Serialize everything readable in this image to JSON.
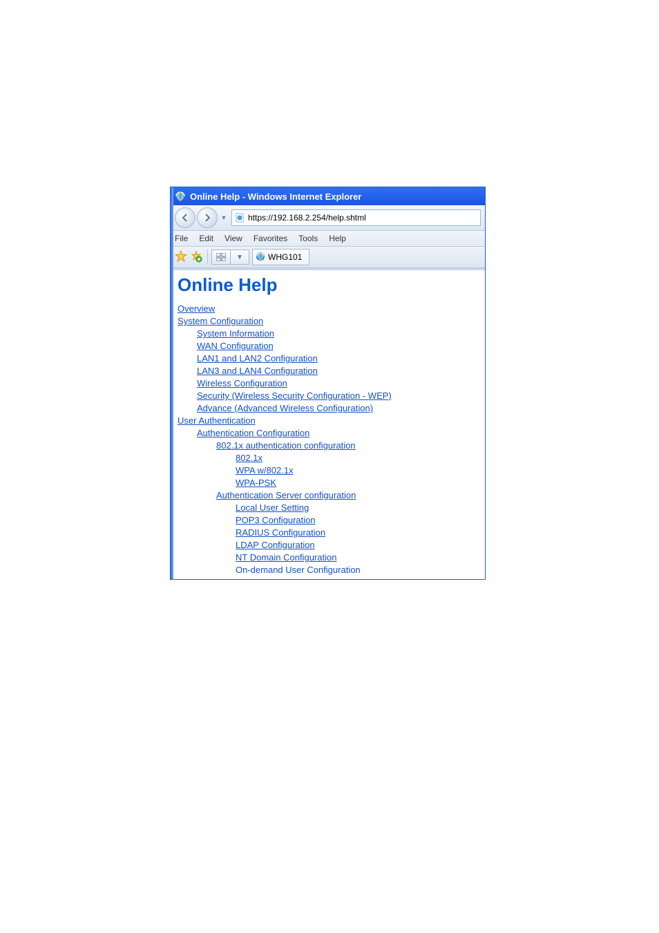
{
  "window": {
    "title": "Online Help - Windows Internet Explorer"
  },
  "address": {
    "url": "https://192.168.2.254/help.shtml"
  },
  "menu": {
    "file": "File",
    "edit": "Edit",
    "view": "View",
    "favorites": "Favorites",
    "tools": "Tools",
    "help": "Help"
  },
  "tab": {
    "label": "WHG101"
  },
  "page": {
    "heading": "Online Help",
    "links": {
      "overview": "Overview",
      "system_configuration": "System Configuration",
      "system_information": "System Information",
      "wan_configuration": "WAN Configuration",
      "lan12": "LAN1 and LAN2 Configuration",
      "lan34": "LAN3 and LAN4 Configuration",
      "wireless": "Wireless Configuration",
      "security": "Security (Wireless Security Configuration - WEP)",
      "advance": "Advance (Advanced Wireless Configuration)",
      "user_auth": "User Authentication",
      "auth_config": "Authentication Configuration",
      "dot1x_config": "802.1x authentication configuration",
      "dot1x": "802.1x",
      "wpa_dot1x": "WPA w/802.1x",
      "wpa_psk": "WPA-PSK",
      "auth_server": "Authentication Server configuration",
      "local_user": "Local User Setting",
      "pop3": "POP3 Configuration",
      "radius": "RADIUS Configuration",
      "ldap": "LDAP Configuration",
      "nt_domain": "NT Domain Configuration",
      "on_demand": "On-demand User Configuration"
    }
  }
}
